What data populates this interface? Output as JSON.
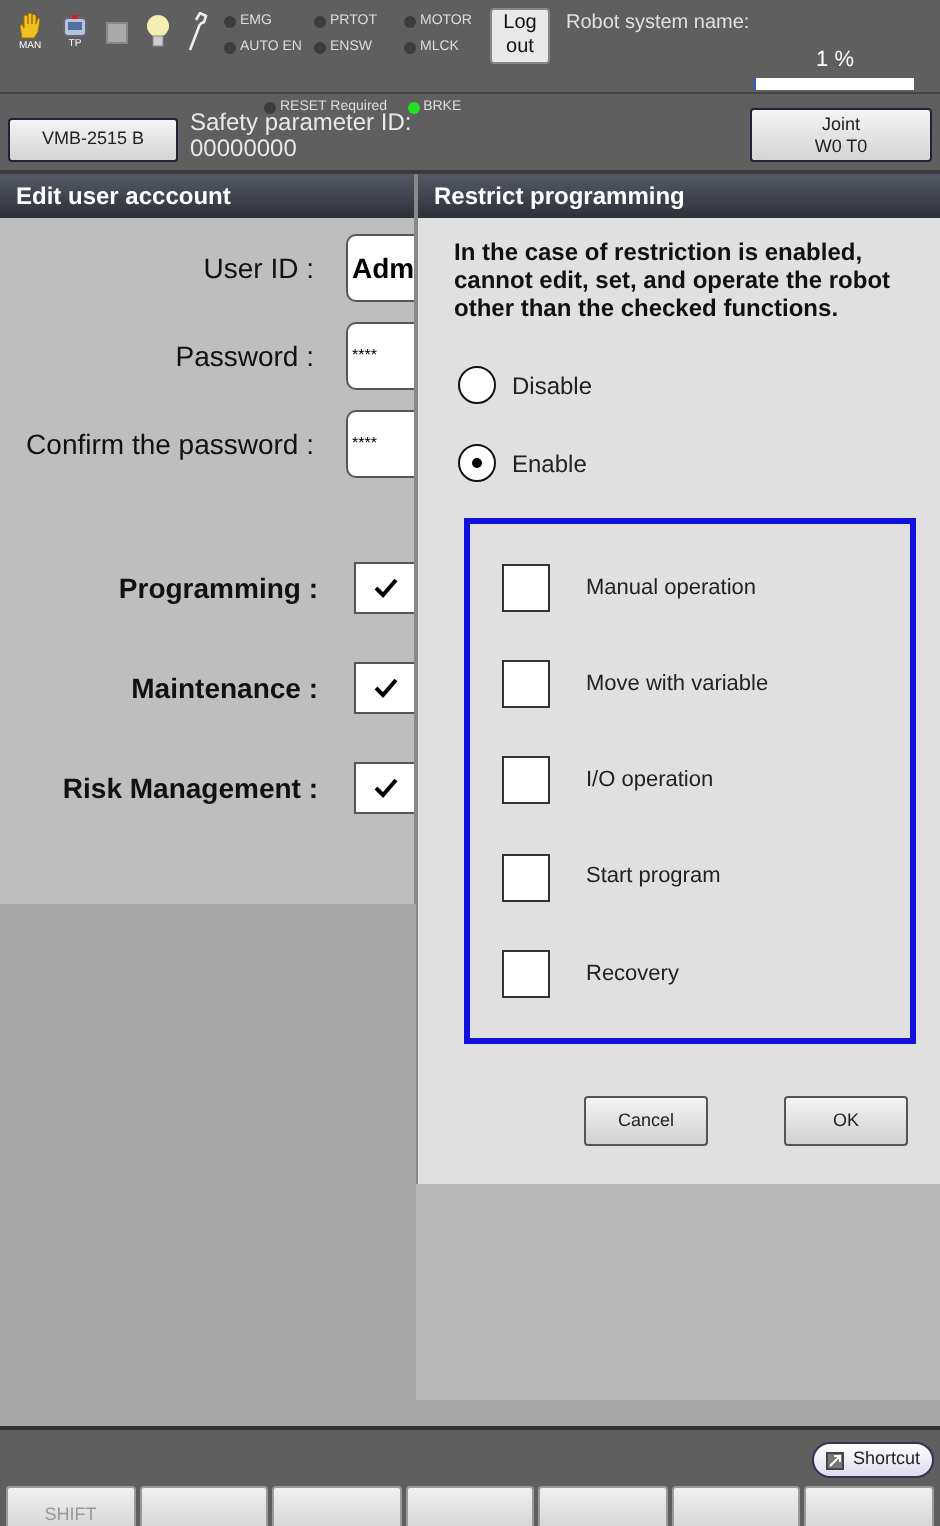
{
  "toolbar": {
    "mode_labels": [
      "MAN",
      "TP"
    ],
    "indicators": [
      {
        "label": "EMG",
        "color": "#3c3c3c"
      },
      {
        "label": "PRTOT",
        "color": "#3c3c3c"
      },
      {
        "label": "MOTOR",
        "color": "#3c3c3c"
      },
      {
        "label": "AUTO EN",
        "color": "#3c3c3c"
      },
      {
        "label": "ENSW",
        "color": "#3c3c3c"
      },
      {
        "label": "MLCK",
        "color": "#3c3c3c"
      }
    ],
    "logout": [
      "Log",
      "out"
    ],
    "system_name_label": "Robot system name:",
    "progress": {
      "reading": "1 %",
      "level": 0.01
    },
    "status_indicators": [
      {
        "label": "RESET Required",
        "color": "#3c3c3c"
      },
      {
        "label": "BRKE",
        "color": "#22e022"
      }
    ],
    "robot_button": "VMB-2515 B",
    "safety_id_label": "Safety parameter ID:",
    "safety_id": "00000000",
    "joint_button": [
      "Joint",
      "W0 T0"
    ]
  },
  "account_panel": {
    "title": "Edit user acccount",
    "fields": [
      {
        "label": "User ID :",
        "value": "Adm",
        "kind": "text"
      },
      {
        "label": "Password :",
        "value": "****",
        "kind": "password"
      },
      {
        "label": "Confirm the password :",
        "value": "****",
        "kind": "password"
      }
    ],
    "permissions": [
      {
        "label": "Programming :",
        "checked": true
      },
      {
        "label": "Maintenance :",
        "checked": true
      },
      {
        "label": "Risk Management :",
        "checked": true
      }
    ]
  },
  "dialog": {
    "title": "Restrict programming",
    "message": "In the case of restriction is enabled, cannot edit, set, and operate the robot other than the checked functions.",
    "options": [
      {
        "label": "Disable",
        "selected": false
      },
      {
        "label": "Enable",
        "selected": true
      }
    ],
    "functions": [
      {
        "label": "Manual operation",
        "checked": false
      },
      {
        "label": "Move with variable",
        "checked": false
      },
      {
        "label": "I/O operation",
        "checked": false
      },
      {
        "label": "Start program",
        "checked": false
      },
      {
        "label": "Recovery",
        "checked": false
      }
    ],
    "buttons": [
      "Cancel",
      "OK"
    ]
  },
  "shortcut_button": "Shortcut",
  "function_keys": [
    {
      "kind": "labeled",
      "label": "SHIFT",
      "disabled": true
    },
    {
      "kind": "blank"
    },
    {
      "kind": "blank"
    },
    {
      "kind": "blank"
    },
    {
      "kind": "blank"
    },
    {
      "kind": "blank"
    },
    {
      "kind": "blank"
    }
  ]
}
